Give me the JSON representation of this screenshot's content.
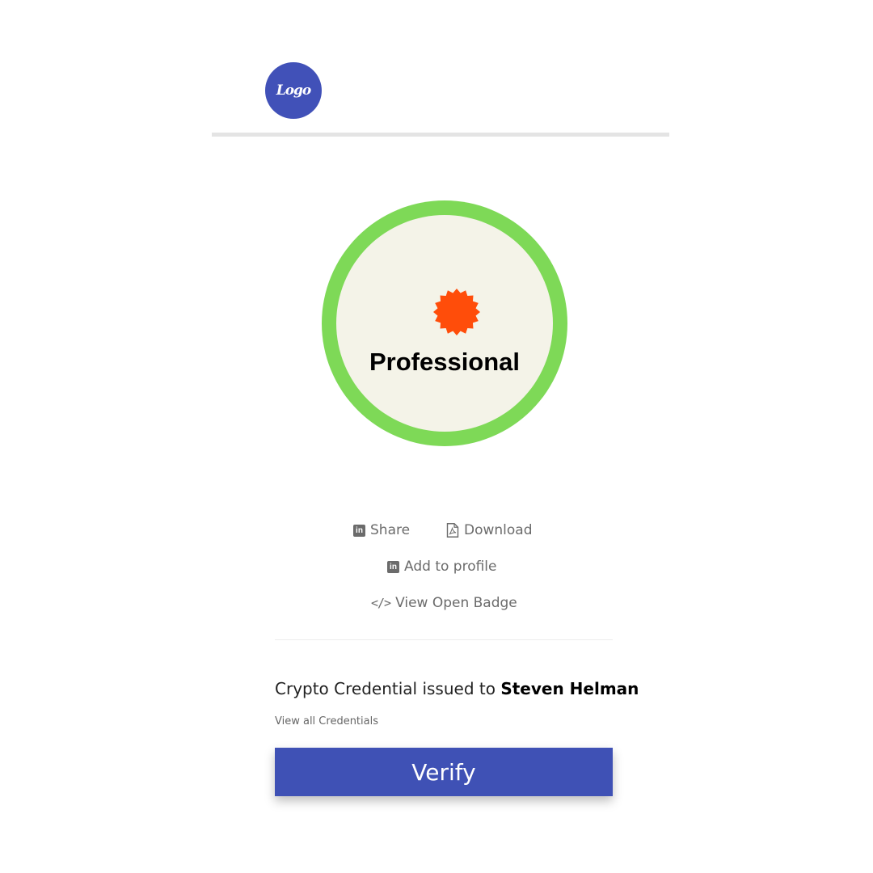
{
  "header": {
    "logo_text": "Logo"
  },
  "badge": {
    "title": "Professional",
    "ring_color": "#7ed957",
    "inner_color": "#f4f3e8",
    "seal_color": "#ff4d0a",
    "seal_icon": "seal-icon"
  },
  "actions": {
    "share_label": "Share",
    "download_label": "Download",
    "add_profile_label": "Add to profile",
    "view_badge_label": "View Open Badge",
    "linkedin_icon_glyph": "in",
    "code_icon_glyph": "</>"
  },
  "credential": {
    "issued_prefix": "Crypto Credential issued to ",
    "recipient": "Steven Helman",
    "view_all_label": "View all Credentials"
  },
  "verify": {
    "label": "Verify",
    "color": "#3f51b5"
  }
}
